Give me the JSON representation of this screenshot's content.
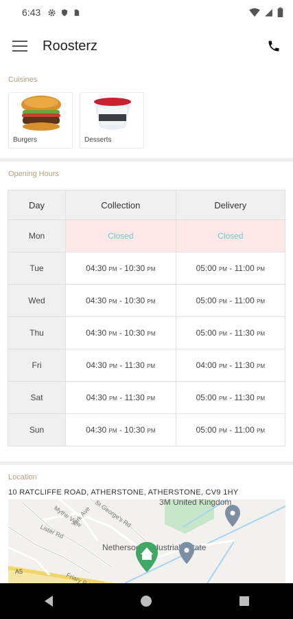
{
  "status": {
    "time": "6:43"
  },
  "header": {
    "title": "Roosterz"
  },
  "cuisines": {
    "section_title": "Cuisines",
    "items": [
      {
        "label": "Burgers"
      },
      {
        "label": "Desserts"
      }
    ]
  },
  "opening_hours": {
    "section_title": "Opening Hours",
    "columns": [
      "Day",
      "Collection",
      "Delivery"
    ],
    "rows": [
      {
        "day": "Mon",
        "collection": "Closed",
        "delivery": "Closed"
      },
      {
        "day": "Tue",
        "collection": {
          "start": "04:30",
          "start_ampm": "PM",
          "end": "10:30",
          "end_ampm": "PM"
        },
        "delivery": {
          "start": "05:00",
          "start_ampm": "PM",
          "end": "11:00",
          "end_ampm": "PM"
        }
      },
      {
        "day": "Wed",
        "collection": {
          "start": "04:30",
          "start_ampm": "PM",
          "end": "10:30",
          "end_ampm": "PM"
        },
        "delivery": {
          "start": "05:00",
          "start_ampm": "PM",
          "end": "11:00",
          "end_ampm": "PM"
        }
      },
      {
        "day": "Thu",
        "collection": {
          "start": "04:30",
          "start_ampm": "PM",
          "end": "10:30",
          "end_ampm": "PM"
        },
        "delivery": {
          "start": "05:00",
          "start_ampm": "PM",
          "end": "11:30",
          "end_ampm": "PM"
        }
      },
      {
        "day": "Fri",
        "collection": {
          "start": "04:30",
          "start_ampm": "PM",
          "end": "11:30",
          "end_ampm": "PM"
        },
        "delivery": {
          "start": "04:00",
          "start_ampm": "PM",
          "end": "11:30",
          "end_ampm": "PM"
        }
      },
      {
        "day": "Sat",
        "collection": {
          "start": "04:30",
          "start_ampm": "PM",
          "end": "11:30",
          "end_ampm": "PM"
        },
        "delivery": {
          "start": "05:00",
          "start_ampm": "PM",
          "end": "11:30",
          "end_ampm": "PM"
        }
      },
      {
        "day": "Sun",
        "collection": {
          "start": "04:30",
          "start_ampm": "PM",
          "end": "10:30",
          "end_ampm": "PM"
        },
        "delivery": {
          "start": "05:00",
          "start_ampm": "PM",
          "end": "11:00",
          "end_ampm": "PM"
        }
      }
    ]
  },
  "location": {
    "section_title": "Location",
    "address": "10 RATCLIFFE ROAD, ATHERSTONE, ATHERSTONE, CV9 1HY",
    "map": {
      "labels": {
        "place1": "3M United Kingdom",
        "place2": "Nethersood Industrial Estate",
        "road1": "St George's Rd",
        "road2": "Mythe View",
        "road3": "York Ave",
        "road4": "Lister Rd",
        "road5": "Friary Rd",
        "road_num": "A5"
      }
    }
  },
  "colors": {
    "accent": "#b3a07f",
    "closed_bg": "#fde7e7",
    "closed_text": "#6cc7cb",
    "pin_green": "#3ea864"
  }
}
